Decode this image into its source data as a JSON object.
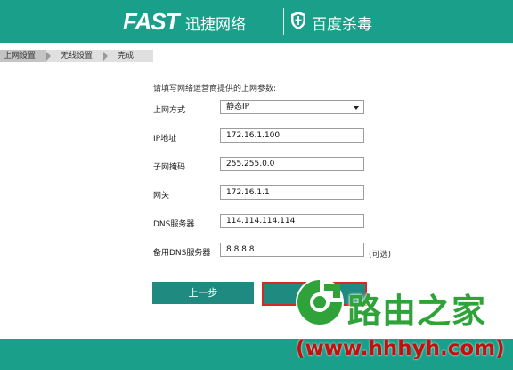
{
  "header": {
    "brand": "FAST",
    "brand_cn": "迅捷网络",
    "partner": "百度杀毒"
  },
  "steps": [
    {
      "label": "上网设置",
      "active": true
    },
    {
      "label": "无线设置",
      "active": false
    },
    {
      "label": "完成",
      "active": false
    }
  ],
  "form": {
    "intro": "请填写网络运营商提供的上网参数:",
    "connection_type_label": "上网方式",
    "connection_type_value": "静态IP",
    "ip_label": "IP地址",
    "ip_value": "172.16.1.100",
    "mask_label": "子网掩码",
    "mask_value": "255.255.0.0",
    "gateway_label": "网关",
    "gateway_value": "172.16.1.1",
    "dns_label": "DNS服务器",
    "dns_value": "114.114.114.114",
    "dns2_label": "备用DNS服务器",
    "dns2_value": "8.8.8.8",
    "optional_hint": "(可选)"
  },
  "buttons": {
    "prev_label": "上一步",
    "next_label": ""
  },
  "watermark": {
    "title": "路由之家",
    "url": "(www.hhhyh.com)"
  },
  "colors": {
    "header_teal": "#1aa08a",
    "button_teal": "#1f8a80",
    "highlight_red": "#d62a2a",
    "watermark_green": "#2fa23a",
    "watermark_red": "#c40f0f"
  }
}
